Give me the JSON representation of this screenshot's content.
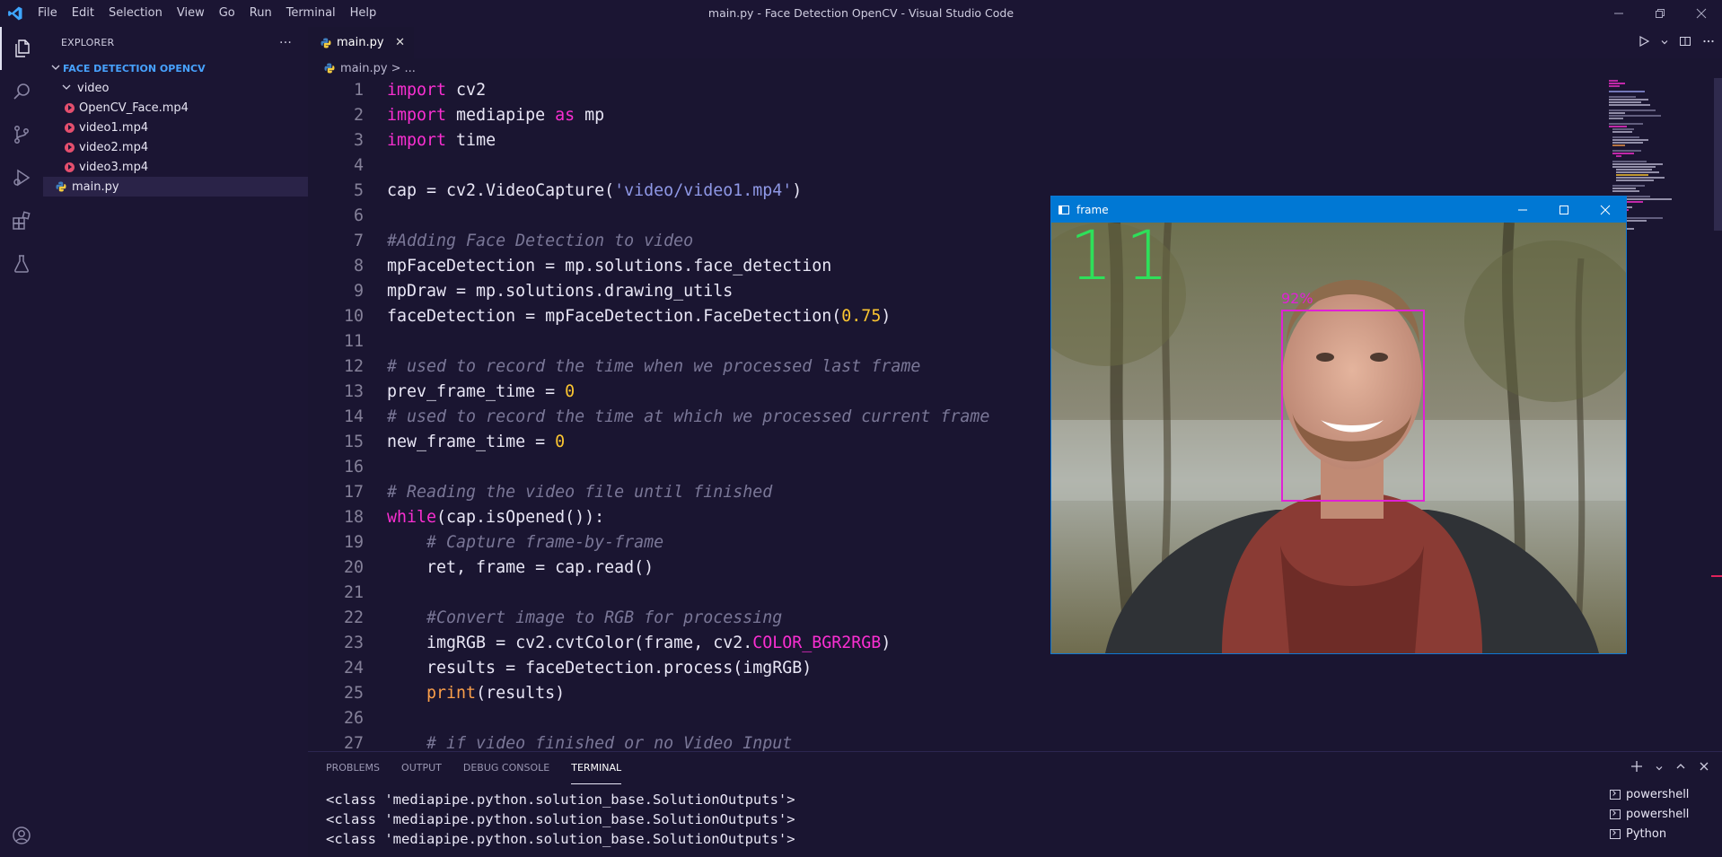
{
  "window": {
    "title": "main.py - Face Detection OpenCV - Visual Studio Code",
    "menu": [
      "File",
      "Edit",
      "Selection",
      "View",
      "Go",
      "Run",
      "Terminal",
      "Help"
    ],
    "controls": [
      "minimize-icon",
      "restore-icon",
      "close-icon"
    ]
  },
  "activity_bar": [
    "files-icon",
    "search-icon",
    "source-control-icon",
    "run-debug-icon",
    "extensions-icon",
    "testing-icon",
    "account-icon"
  ],
  "sidebar": {
    "header": "EXPLORER",
    "more": "···",
    "folder": "FACE DETECTION OPENCV",
    "tree": [
      {
        "label": "video",
        "type": "folder",
        "depth": 1
      },
      {
        "label": "OpenCV_Face.mp4",
        "type": "mp4",
        "depth": 2
      },
      {
        "label": "video1.mp4",
        "type": "mp4",
        "depth": 2
      },
      {
        "label": "video2.mp4",
        "type": "mp4",
        "depth": 2
      },
      {
        "label": "video3.mp4",
        "type": "mp4",
        "depth": 2
      },
      {
        "label": "main.py",
        "type": "py",
        "depth": 1,
        "selected": true
      }
    ]
  },
  "editor": {
    "tab": {
      "label": "main.py",
      "close": "✕"
    },
    "breadcrumb": {
      "file": "main.py",
      "sep": ">",
      "rest": "..."
    },
    "lines": [
      {
        "n": "1"
      },
      {
        "n": "2"
      },
      {
        "n": "3"
      },
      {
        "n": "4"
      },
      {
        "n": "5"
      },
      {
        "n": "6"
      },
      {
        "n": "7"
      },
      {
        "n": "8"
      },
      {
        "n": "9"
      },
      {
        "n": "10"
      },
      {
        "n": "11"
      },
      {
        "n": "12"
      },
      {
        "n": "13"
      },
      {
        "n": "14"
      },
      {
        "n": "15"
      },
      {
        "n": "16"
      },
      {
        "n": "17"
      },
      {
        "n": "18"
      },
      {
        "n": "19"
      },
      {
        "n": "20"
      },
      {
        "n": "21"
      },
      {
        "n": "22"
      },
      {
        "n": "23"
      },
      {
        "n": "24"
      },
      {
        "n": "25"
      },
      {
        "n": "26"
      },
      {
        "n": "27"
      }
    ],
    "code": {
      "l1_kw": "import",
      "l1_rest": " cv2",
      "l2_kw": "import",
      "l2_mid": " mediapipe ",
      "l2_kw2": "as",
      "l2_rest": " mp",
      "l3_kw": "import",
      "l3_rest": " time",
      "l5_a": "cap = cv2.VideoCapture(",
      "l5_str": "'video/video1.mp4'",
      "l5_b": ")",
      "l7_cm": "#Adding Face Detection to video",
      "l8": "mpFaceDetection = mp.solutions.face_detection",
      "l9": "mpDraw = mp.solutions.drawing_utils",
      "l10_a": "faceDetection = mpFaceDetection.FaceDetection(",
      "l10_num": "0.75",
      "l10_b": ")",
      "l12_cm": "# used to record the time when we processed last frame",
      "l13_a": "prev_frame_time = ",
      "l13_num": "0",
      "l14_cm": "# used to record the time at which we processed current frame",
      "l15_a": "new_frame_time = ",
      "l15_num": "0",
      "l17_cm": "# Reading the video file until finished",
      "l18_kw": "while",
      "l18_rest": "(cap.isOpened()):",
      "l19_cm": "    # Capture frame-by-frame",
      "l20": "    ret, frame = cap.read()",
      "l22_cm": "    #Convert image to RGB for processing",
      "l23_a": "    imgRGB = cv2.cvtColor(frame, cv2.",
      "l23_const": "COLOR_BGR2RGB",
      "l23_b": ")",
      "l24": "    results = faceDetection.process(imgRGB)",
      "l25_fn": "    print",
      "l25_rest": "(results)",
      "l27_cm": "    # if video finished or no Video Input"
    },
    "actions": [
      "run-icon",
      "split-editor-icon",
      "more-actions-icon"
    ]
  },
  "frame_window": {
    "title": "frame",
    "fps": "11",
    "detection": {
      "label": "92%",
      "score": 0.92
    },
    "colors": {
      "fps": "#2ee05a",
      "box": "#e021d6",
      "titlebar": "#0078d4"
    }
  },
  "panel": {
    "tabs": [
      "PROBLEMS",
      "OUTPUT",
      "DEBUG CONSOLE",
      "TERMINAL"
    ],
    "active_tab": "TERMINAL",
    "terminal_lines": [
      "<class 'mediapipe.python.solution_base.SolutionOutputs'>",
      "<class 'mediapipe.python.solution_base.SolutionOutputs'>",
      "<class 'mediapipe.python.solution_base.SolutionOutputs'>"
    ],
    "terminals": [
      "powershell",
      "powershell",
      "Python"
    ]
  },
  "theme": {
    "background": "#1a1531",
    "keyword": "#f92fd1",
    "string": "#8f98e6",
    "number": "#fbc531",
    "comment": "#7a7797",
    "accent": "#47a2ff"
  }
}
